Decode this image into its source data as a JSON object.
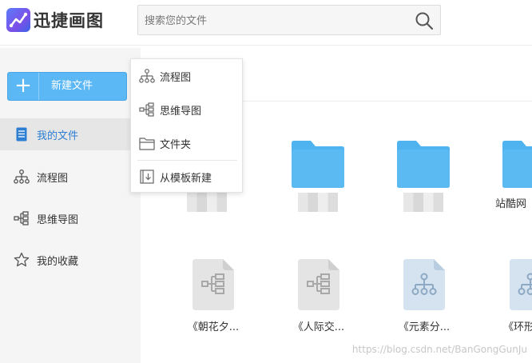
{
  "app": {
    "name": "迅捷画图",
    "brand_color": "#5b7cfa"
  },
  "search": {
    "placeholder": "搜索您的文件",
    "value": ""
  },
  "sidebar": {
    "new_file_label": "新建文件",
    "accent": "#5bb8f5",
    "items": [
      {
        "label": "我的文件",
        "icon": "document-icon",
        "active": true
      },
      {
        "label": "流程图",
        "icon": "flowchart-icon",
        "active": false
      },
      {
        "label": "思维导图",
        "icon": "mindmap-icon",
        "active": false
      },
      {
        "label": "我的收藏",
        "icon": "star-icon",
        "active": false
      }
    ]
  },
  "dropdown": {
    "items": [
      {
        "label": "流程图",
        "icon": "flowchart-icon"
      },
      {
        "label": "思维导图",
        "icon": "mindmap-icon"
      },
      {
        "label": "文件夹",
        "icon": "folder-icon"
      },
      {
        "label": "从模板新建",
        "icon": "template-icon"
      }
    ]
  },
  "files": {
    "row1": [
      {
        "type": "folder",
        "name": ""
      },
      {
        "type": "folder",
        "name": ""
      },
      {
        "type": "folder",
        "name": ""
      },
      {
        "type": "folder",
        "name": "站酷网"
      }
    ],
    "row2": [
      {
        "type": "mindmap",
        "name": "《朝花夕..."
      },
      {
        "type": "mindmap",
        "name": "《人际交..."
      },
      {
        "type": "flowchart",
        "name": "《元素分..."
      },
      {
        "type": "flowchart",
        "name": "《环形..."
      }
    ],
    "folder_color": "#4fb3ef"
  },
  "watermark": "https://blog.csdn.net/BanGongGunJu"
}
